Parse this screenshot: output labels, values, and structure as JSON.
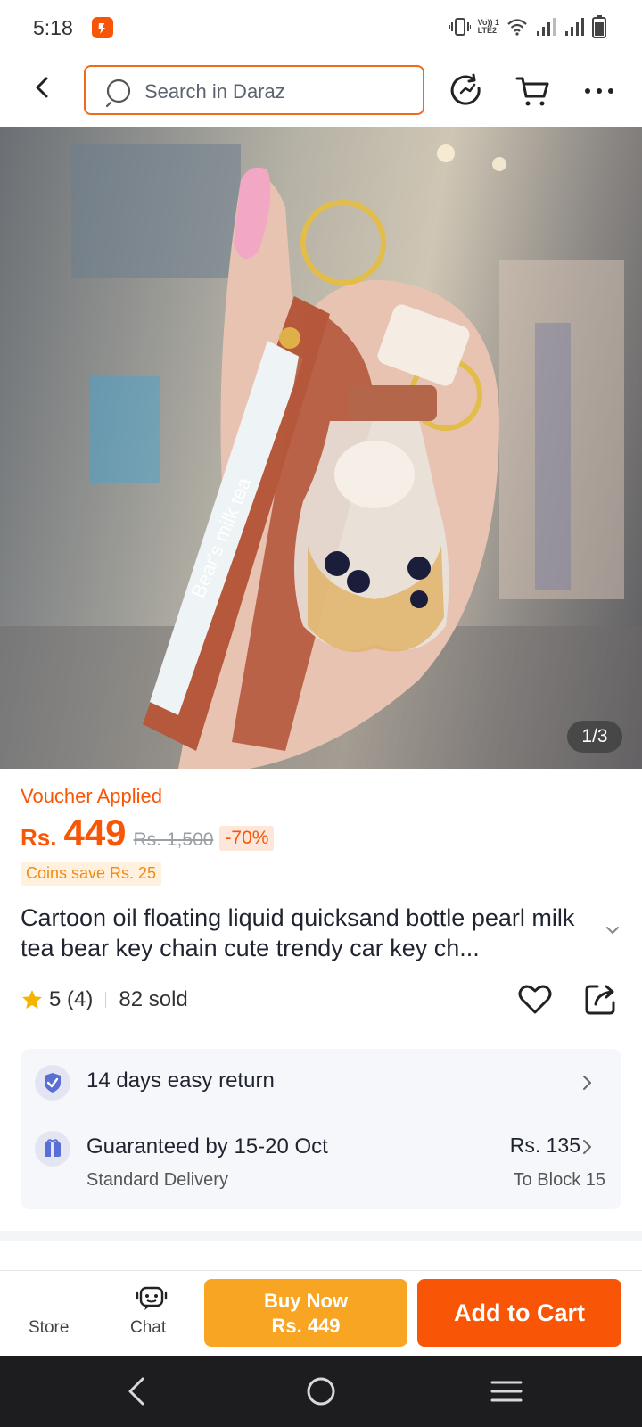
{
  "status_bar": {
    "time": "5:18",
    "network_label_top": "Vo)) 1",
    "network_label_bottom": "LTE2"
  },
  "header": {
    "search_placeholder": "Search in Daraz",
    "icons": [
      "back-icon",
      "history-icon",
      "cart-icon",
      "more-icon"
    ]
  },
  "gallery": {
    "counter": "1/3",
    "print_text": "Bear's milk tea"
  },
  "product": {
    "voucher_label": "Voucher Applied",
    "currency": "Rs.",
    "price": "449",
    "original_price": "Rs. 1,500",
    "discount": "-70%",
    "coins_text": "Coins save Rs. 25",
    "title": "Cartoon oil floating liquid quicksand bottle pearl milk tea bear key chain cute trendy car key ch...",
    "rating_text": "5 (4)",
    "sold_text": "82 sold"
  },
  "delivery": {
    "return_text": "14 days easy return",
    "guarantee_text": "Guaranteed by 15-20 Oct",
    "delivery_type": "Standard Delivery",
    "shipping_fee": "Rs. 135",
    "location": "To Block 15"
  },
  "bottom_bar": {
    "store_label": "Store",
    "chat_label": "Chat",
    "buy_now_label": "Buy Now",
    "buy_now_price": "Rs. 449",
    "add_to_cart_label": "Add to Cart"
  },
  "colors": {
    "brand_orange": "#f85606",
    "buy_now": "#f9a524",
    "star": "#f5b400"
  }
}
